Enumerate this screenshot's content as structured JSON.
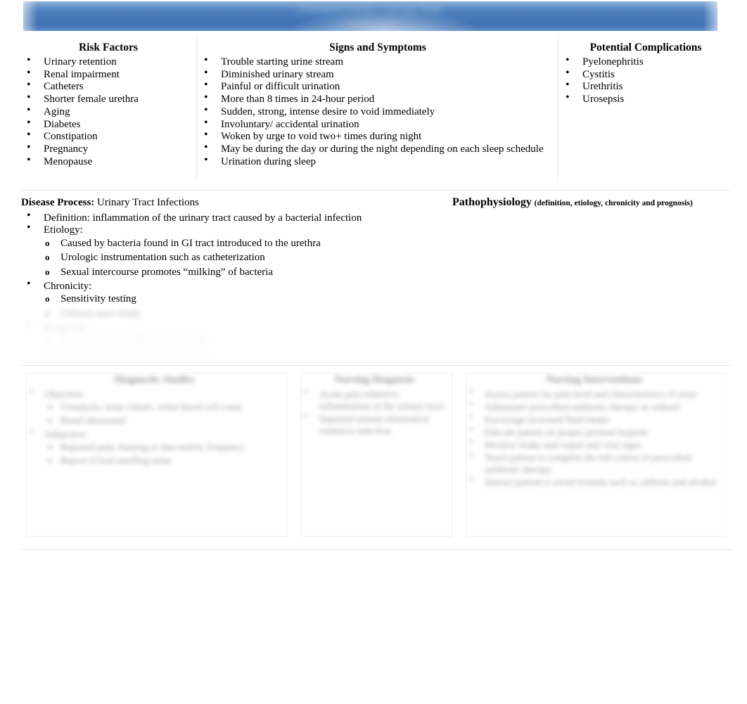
{
  "document": {
    "title_bar": {
      "title": "Pathophysiology Concept Map",
      "subtitle": "Student Name",
      "bar_color": "#4a7ebb",
      "redacted": true
    }
  },
  "top_row": {
    "risk_factors": {
      "title": "Risk Factors",
      "items": [
        "Urinary retention",
        "Renal impairment",
        "Catheters",
        "Shorter female urethra",
        "Aging",
        "Diabetes",
        "Constipation",
        "Pregnancy",
        "Menopause"
      ]
    },
    "signs_and_symptoms": {
      "title": "Signs and Symptoms",
      "items": [
        "Trouble starting urine stream",
        "Diminished urinary stream",
        "Painful or difficult urination",
        "More than 8 times in 24-hour period",
        "Sudden, strong, intense desire to void immediately",
        "Involuntary/ accidental urination",
        "Woken by urge to void two+ times during night",
        "May be during the day or during the night depending on each sleep schedule",
        "Urination during sleep"
      ]
    },
    "potential_complications": {
      "title": "Potential Complications",
      "items": [
        "Pyelonephritis",
        "Cystitis",
        "Urethritis",
        "Urosepsis"
      ]
    }
  },
  "middle": {
    "disease_process_label": "Disease Process:",
    "disease_process_value": "Urinary Tract Infections",
    "pathophysiology_heading": "Pathophysiology",
    "pathophysiology_subheading": "(definition, etiology, chronicity and prognosis)",
    "definition_item": "Definition: inflammation of the urinary tract caused by a bacterial infection",
    "etiology_label": "Etiology:",
    "etiology_items": [
      "Caused by bacteria found in GI tract introduced to the urethra",
      "Urologic instrumentation such as catheterization",
      "Sexual intercourse promotes “milking” of bacteria"
    ],
    "chronicity_label": "Chronicity:",
    "chronicity_items": [
      "Sensitivity testing",
      "Urinary tract study"
    ],
    "prognosis_label": "Prognosis:",
    "prognosis_items": [
      "Completion of antibiotic treatment",
      "Treatment of underlying conditions"
    ]
  },
  "bottom_row": {
    "left_box": {
      "title": "Diagnostic Studies",
      "items": [
        "Objective:",
        "Subjective:"
      ],
      "sub_items_a": [
        "Urinalysis, urine culture, white blood cell count",
        "Renal ultrasound"
      ],
      "sub_items_b": [
        "Reported pain, burning or discomfort, frequency",
        "Report of foul smelling urine"
      ]
    },
    "mid_box": {
      "title": "Nursing Diagnosis",
      "items": [
        "Acute pain related to inflammation of the urinary tract",
        "Impaired urinary elimination related to infection"
      ]
    },
    "right_box": {
      "title": "Nursing Interventions",
      "items": [
        "Assess patient for pain level and characteristics of urine",
        "Administer prescribed antibiotic therapy as ordered",
        "Encourage increased fluid intake",
        "Educate patient on proper perineal hygiene",
        "Monitor intake and output and vital signs",
        "Teach patient to complete the full course of prescribed antibiotic therapy",
        "Instruct patient to avoid irritants such as caffeine and alcohol"
      ]
    }
  }
}
